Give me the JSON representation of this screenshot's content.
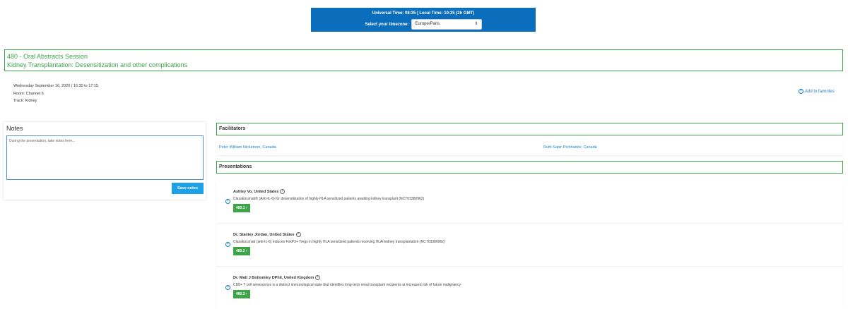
{
  "timezone": {
    "times_text": "Universal Time: 08:35  |  Local Time: 10:35 (2h GMT)",
    "select_label": "Select your timezone:",
    "select_value": "Europe/Paris"
  },
  "session": {
    "line1": "480 - Oral Abstracts Session",
    "line2": "Kidney Transplantation: Desensitization and other complications"
  },
  "meta": {
    "date": "Wednesday September 16, 2020 | 16:30 to 17:15",
    "room": "Room: Channel 6",
    "track": "Track: Kidney"
  },
  "favorites": {
    "label": "Add to favorites"
  },
  "notes": {
    "title": "Notes",
    "placeholder": "During the presentation, take notes here...",
    "save_label": "Save notes"
  },
  "facilitators": {
    "heading": "Facilitators",
    "people": [
      "Peter William Nickerson, Canada",
      "Ruth Sapir-Pichhadze, Canada"
    ]
  },
  "presentations": {
    "heading": "Presentations",
    "items": [
      {
        "author": "Ashley Vo, United States",
        "title": "Clazakizumab® (Anti-IL-6) for desensitization of highly-HLA sensitized patients awaiting kidney transplant (NCT03380962)",
        "code": "480.1"
      },
      {
        "author": "Dr. Stanley Jordan, United States",
        "title": "Clazakizumab (anti-IL-6) induces FoxP3+ Tregs in highly HLA sensitized patients receiving HLAi kidney transplantation (NCT03380962)",
        "code": "480.2"
      },
      {
        "author": "Dr. Matt J Bottomley DPhil, United Kingdom",
        "title": "CD8+ T cell senescence is a distinct immunological state that identifies long-term renal transplant recipients at increased risk of future malignancy",
        "code": "480.3"
      }
    ]
  }
}
